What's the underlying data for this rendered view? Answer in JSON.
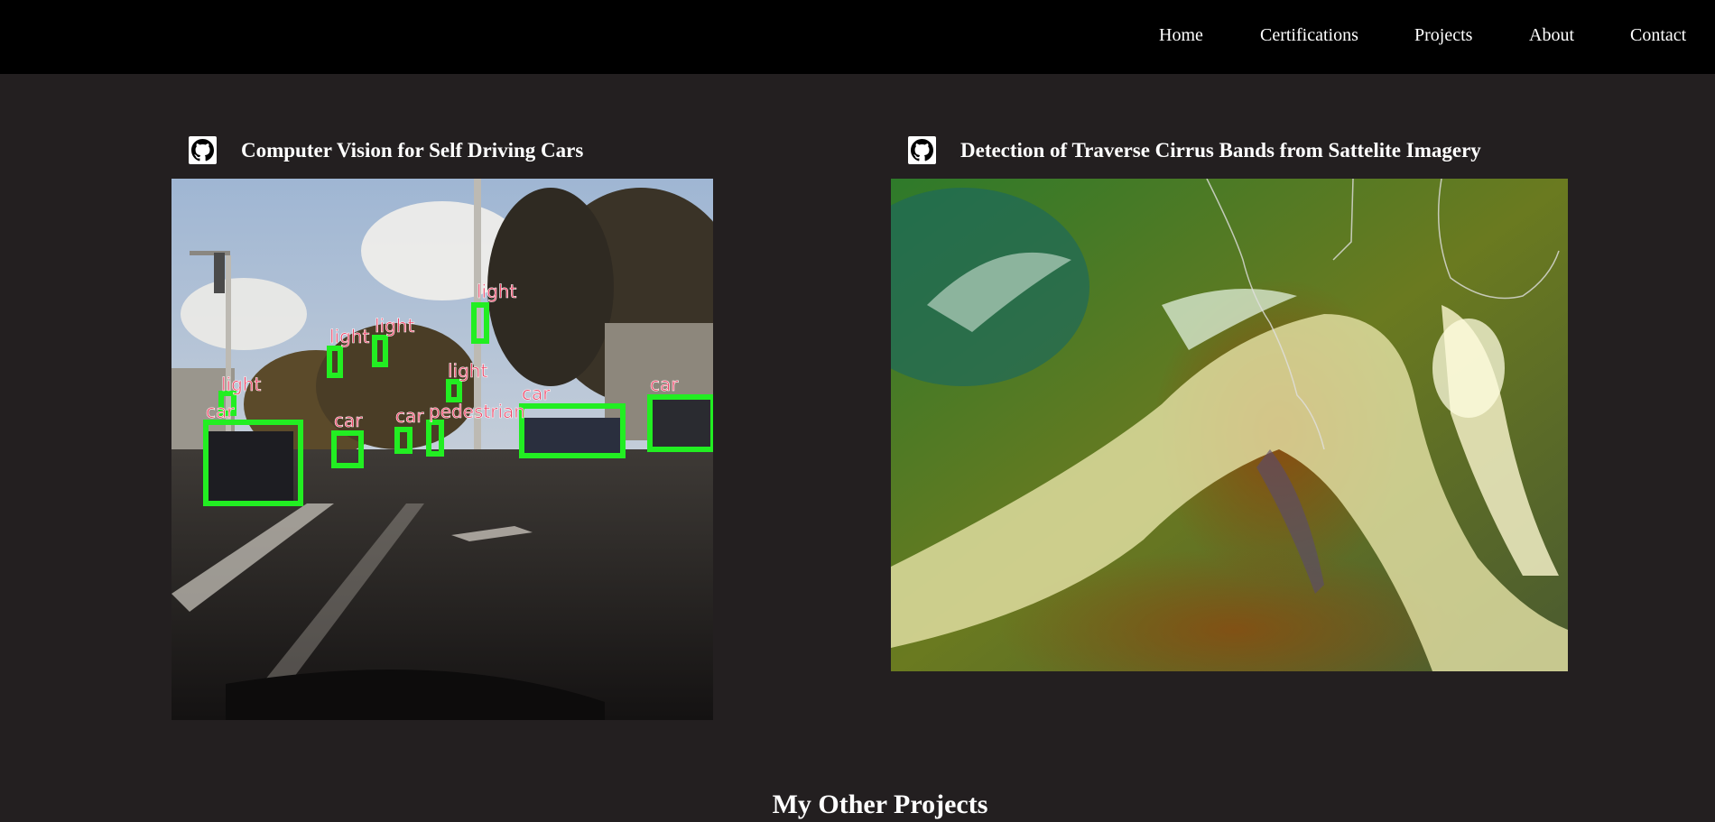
{
  "nav": {
    "items": [
      {
        "label": "Home"
      },
      {
        "label": "Certifications"
      },
      {
        "label": "Projects"
      },
      {
        "label": "About"
      },
      {
        "label": "Contact"
      }
    ]
  },
  "projects": [
    {
      "title": "Computer Vision for Self Driving Cars",
      "icon": "github-icon",
      "detections": [
        "light",
        "light",
        "light",
        "light",
        "light",
        "car",
        "car",
        "car",
        "pedestrian",
        "car",
        "car"
      ]
    },
    {
      "title": "Detection of Traverse Cirrus Bands from Sattelite Imagery",
      "icon": "github-icon"
    }
  ],
  "other_projects": {
    "title": "My Other Projects"
  },
  "colors": {
    "background": "#231f20",
    "navbar": "#000000",
    "text": "#ffffff",
    "detection_box": "#22ee22",
    "detection_label": "#ee4466"
  }
}
